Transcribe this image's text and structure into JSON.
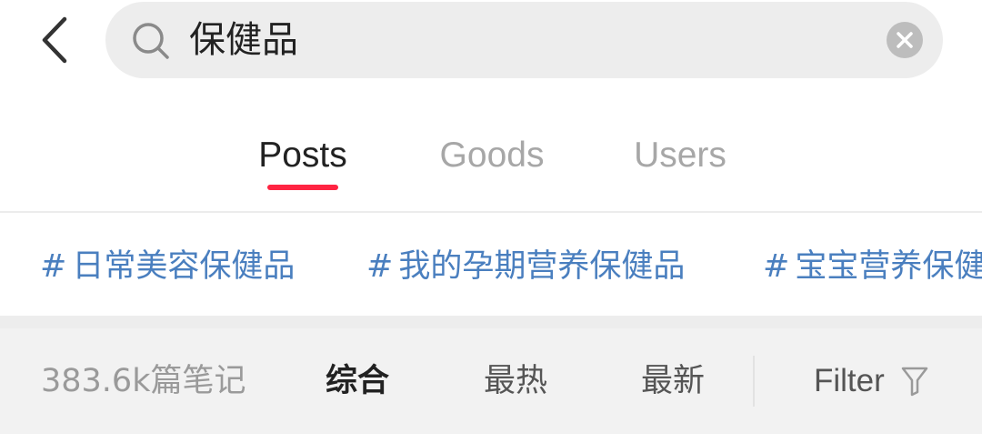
{
  "search": {
    "query": "保健品"
  },
  "tabs": [
    {
      "label": "Posts",
      "active": true
    },
    {
      "label": "Goods",
      "active": false
    },
    {
      "label": "Users",
      "active": false
    }
  ],
  "tags": [
    {
      "hash": "#",
      "label": "日常美容保健品"
    },
    {
      "hash": "#",
      "label": "我的孕期营养保健品"
    },
    {
      "hash": "#",
      "label": "宝宝营养保健品"
    }
  ],
  "sortbar": {
    "count": "383.6k篇笔记",
    "options": [
      {
        "label": "综合",
        "selected": true
      },
      {
        "label": "最热",
        "selected": false
      },
      {
        "label": "最新",
        "selected": false
      }
    ],
    "filter_label": "Filter"
  },
  "icons": {
    "back": "chevron-left-icon",
    "search": "search-icon",
    "clear": "clear-icon",
    "filter": "funnel-icon"
  },
  "colors": {
    "accent": "#ff2442",
    "tag": "#4a7fbf",
    "search_bg": "#ededed",
    "sortbar_bg": "#f2f2f2"
  }
}
